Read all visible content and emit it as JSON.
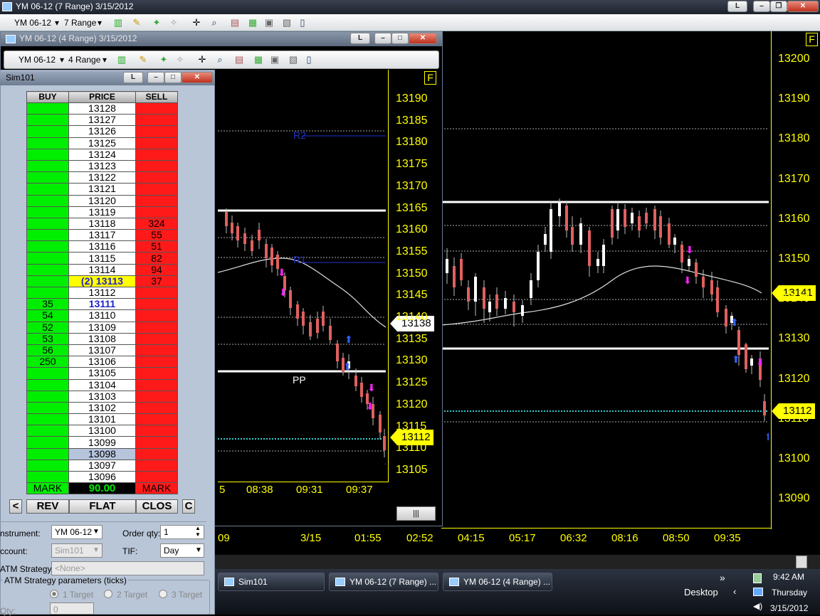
{
  "main_window": {
    "title": "YM 06-12 (7 Range)  3/15/2012",
    "toolbar": {
      "instrument": "YM 06-12",
      "range": "7 Range"
    },
    "btn_l": "L",
    "f_marker": "F",
    "price_axis": [
      "13200",
      "13190",
      "13180",
      "13170",
      "13160",
      "13150",
      "13140",
      "13130",
      "13120",
      "13110",
      "13100",
      "13090"
    ],
    "time_axis": [
      "09",
      "3/15",
      "01:55",
      "02:52",
      "04:15",
      "05:17",
      "06:32",
      "08:16",
      "08:50",
      "09:35"
    ],
    "current_price": "13112",
    "marker_price": "13141"
  },
  "second_window": {
    "title": "YM 06-12 (4 Range)  3/15/2012",
    "toolbar": {
      "instrument": "YM 06-12",
      "range": "4 Range"
    },
    "btn_l": "L",
    "f_marker": "F",
    "price_axis": [
      "13190",
      "13185",
      "13180",
      "13175",
      "13170",
      "13165",
      "13160",
      "13155",
      "13150",
      "13145",
      "13140",
      "13135",
      "13130",
      "13125",
      "13120",
      "13115",
      "13110",
      "13105"
    ],
    "time_axis": [
      "5",
      "08:38",
      "09:31",
      "09:37"
    ],
    "pivot_labels": {
      "r2": "R2",
      "r1": "R1",
      "pp": "PP"
    },
    "current_price": "13112",
    "marker_price": "13138"
  },
  "dom_window": {
    "title": "Sim101",
    "btn_l": "L",
    "headers": {
      "buy": "BUY",
      "price": "PRICE",
      "sell": "SELL"
    },
    "rows": [
      {
        "buy": "",
        "price": "13128",
        "sell": ""
      },
      {
        "buy": "",
        "price": "13127",
        "sell": ""
      },
      {
        "buy": "",
        "price": "13126",
        "sell": ""
      },
      {
        "buy": "",
        "price": "13125",
        "sell": ""
      },
      {
        "buy": "",
        "price": "13124",
        "sell": ""
      },
      {
        "buy": "",
        "price": "13123",
        "sell": ""
      },
      {
        "buy": "",
        "price": "13122",
        "sell": ""
      },
      {
        "buy": "",
        "price": "13121",
        "sell": ""
      },
      {
        "buy": "",
        "price": "13120",
        "sell": ""
      },
      {
        "buy": "",
        "price": "13119",
        "sell": ""
      },
      {
        "buy": "",
        "price": "13118",
        "sell": "324"
      },
      {
        "buy": "",
        "price": "13117",
        "sell": "55"
      },
      {
        "buy": "",
        "price": "13116",
        "sell": "51"
      },
      {
        "buy": "",
        "price": "13115",
        "sell": "82"
      },
      {
        "buy": "",
        "price": "13114",
        "sell": "94"
      },
      {
        "buy": "",
        "price": "(2) 13113",
        "sell": "37"
      },
      {
        "buy": "",
        "price": "13112",
        "sell": ""
      },
      {
        "buy": "35",
        "price": "13111",
        "sell": ""
      },
      {
        "buy": "54",
        "price": "13110",
        "sell": ""
      },
      {
        "buy": "52",
        "price": "13109",
        "sell": ""
      },
      {
        "buy": "53",
        "price": "13108",
        "sell": ""
      },
      {
        "buy": "56",
        "price": "13107",
        "sell": ""
      },
      {
        "buy": "250",
        "price": "13106",
        "sell": ""
      },
      {
        "buy": "",
        "price": "13105",
        "sell": ""
      },
      {
        "buy": "",
        "price": "13104",
        "sell": ""
      },
      {
        "buy": "",
        "price": "13103",
        "sell": ""
      },
      {
        "buy": "",
        "price": "13102",
        "sell": ""
      },
      {
        "buy": "",
        "price": "13101",
        "sell": ""
      },
      {
        "buy": "",
        "price": "13100",
        "sell": ""
      },
      {
        "buy": "",
        "price": "13099",
        "sell": ""
      },
      {
        "buy": "",
        "price": "13098",
        "sell": ""
      },
      {
        "buy": "",
        "price": "13097",
        "sell": ""
      },
      {
        "buy": "",
        "price": "13096",
        "sell": ""
      }
    ],
    "footer": {
      "mark_left": "MARK",
      "pnl": "90.00",
      "mark_right": "MARK"
    },
    "buttons": {
      "left": "<",
      "rev": "REV",
      "flat": "FLAT",
      "clos": "CLOS",
      "c": "C"
    },
    "form": {
      "instrument_label": "nstrument:",
      "instrument_value": "YM 06-12",
      "order_qty_label": "Order qty:",
      "order_qty_value": "1",
      "account_label": "ccount:",
      "account_value": "Sim101",
      "tif_label": "TIF:",
      "tif_value": "Day",
      "atm_label": "ATM Strategy:",
      "atm_value": "<None>",
      "atm_params_label": "ATM Strategy parameters (ticks)",
      "target1": "1 Target",
      "target2": "2 Target",
      "target3": "3 Target",
      "qty_label": "Qty:",
      "qty_value": "0"
    }
  },
  "taskbar": {
    "items": [
      "Sim101",
      "YM 06-12 (7 Range) ...",
      "YM 06-12 (4 Range) ..."
    ],
    "desktop": "Desktop",
    "chevron": "»",
    "time": "9:42 AM",
    "day": "Thursday",
    "date": "3/15/2012"
  },
  "colors": {
    "up_candle": "#ffffff",
    "down_candle": "#e06060",
    "axis": "#ffff00",
    "buy": "#00ee00",
    "sell": "#ff1a1a",
    "marker_pink": "#ff22ff",
    "marker_blue": "#3060ff",
    "cyan_line": "#33cccc"
  }
}
